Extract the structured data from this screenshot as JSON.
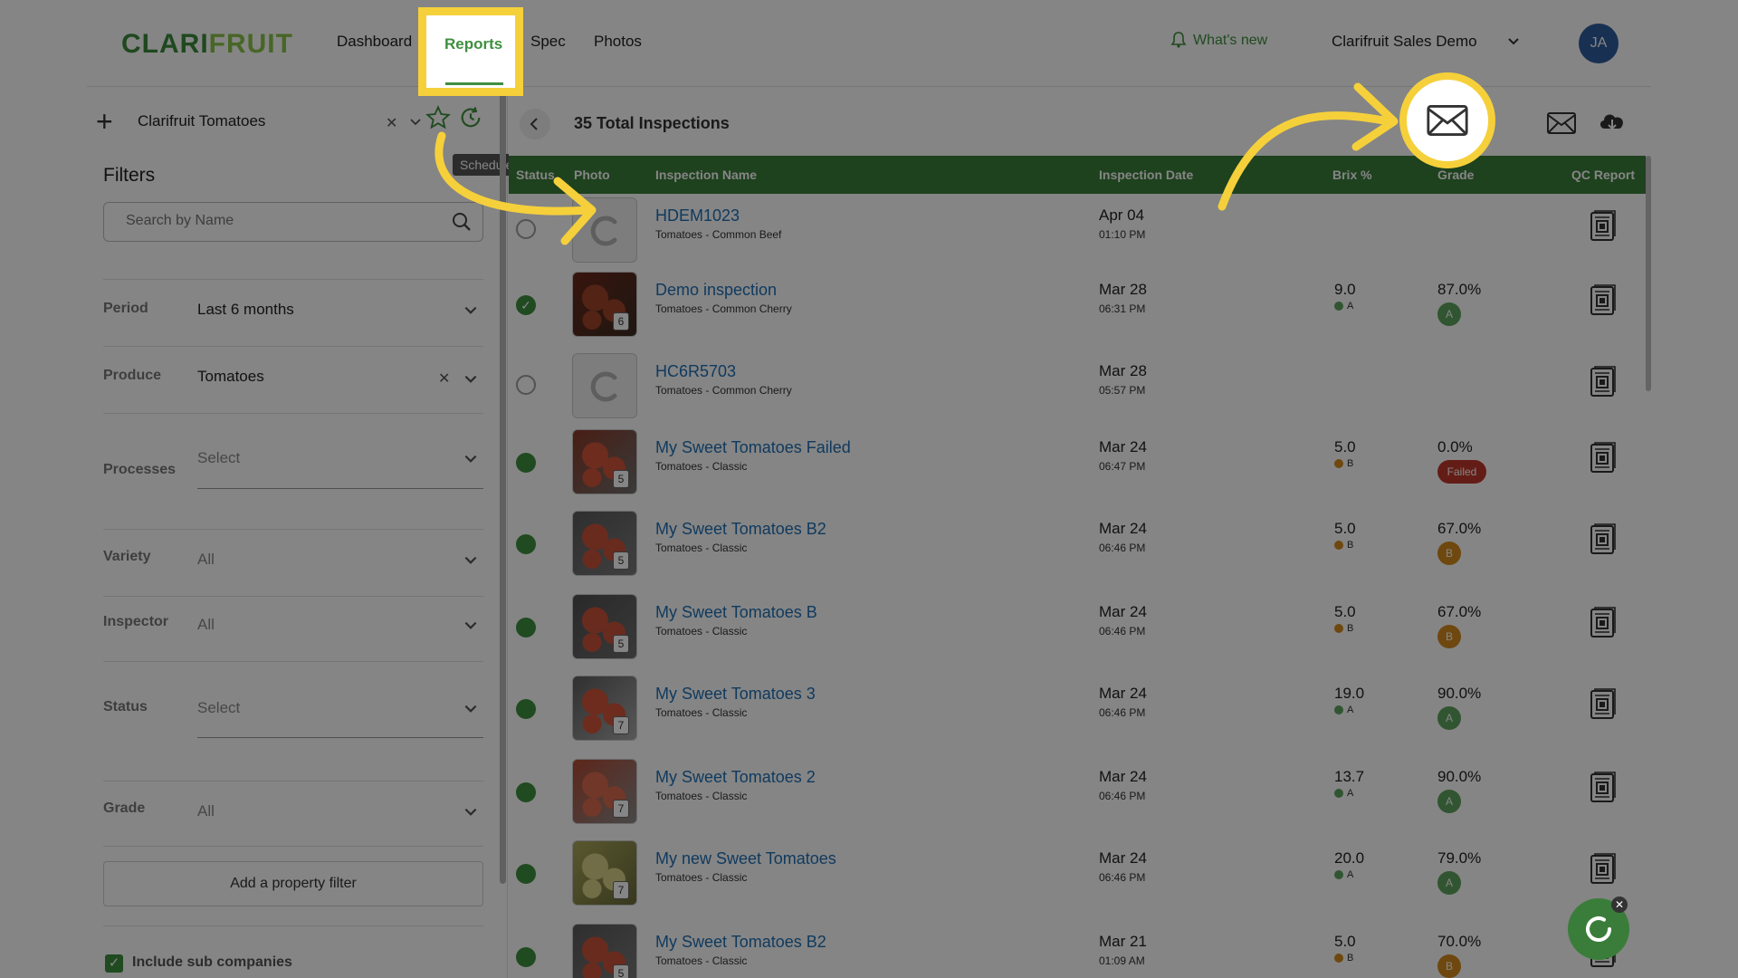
{
  "nav": {
    "logo_main": "CLARI",
    "logo_accent": "FRUIT",
    "items": [
      {
        "label": "Dashboard"
      },
      {
        "label": "Reports"
      },
      {
        "label": "Spec"
      },
      {
        "label": "Photos"
      }
    ],
    "whats_new": "What's new",
    "company": "Clarifruit Sales Demo",
    "avatar": "JA"
  },
  "sidebar": {
    "saved_view": "Clarifruit Tomatoes",
    "tooltip": "Schedule",
    "filters_title": "Filters",
    "search_placeholder": "Search by Name",
    "filters": [
      {
        "label": "Period",
        "value": "Last 6 months"
      },
      {
        "label": "Produce",
        "value": "Tomatoes"
      },
      {
        "label": "Processes",
        "value": "Select"
      },
      {
        "label": "Variety",
        "value": "All"
      },
      {
        "label": "Inspector",
        "value": "All"
      },
      {
        "label": "Status",
        "value": "Select"
      },
      {
        "label": "Grade",
        "value": "All"
      }
    ],
    "add_filter": "Add a property filter",
    "include_sub": "Include sub companies"
  },
  "main": {
    "total": "35 Total Inspections",
    "columns": {
      "status": "Status",
      "photo": "Photo",
      "name": "Inspection Name",
      "date": "Inspection Date",
      "brix": "Brix %",
      "grade": "Grade",
      "qc": "QC Report"
    },
    "rows": [
      {
        "name": "HDEM1023",
        "sub": "Tomatoes - Common Beef",
        "date": "Apr 04",
        "time": "01:10 PM",
        "brix": "",
        "brix_grade": "",
        "grade": "",
        "badge": "",
        "photo_count": ""
      },
      {
        "name": "Demo inspection",
        "sub": "Tomatoes - Common Cherry",
        "date": "Mar 28",
        "time": "06:31 PM",
        "brix": "9.0",
        "brix_grade": "A",
        "grade": "87.0%",
        "badge": "A",
        "photo_count": "6"
      },
      {
        "name": "HC6R5703",
        "sub": "Tomatoes - Common Cherry",
        "date": "Mar 28",
        "time": "05:57 PM",
        "brix": "",
        "brix_grade": "",
        "grade": "",
        "badge": "",
        "photo_count": ""
      },
      {
        "name": "My Sweet Tomatoes Failed",
        "sub": "Tomatoes - Classic",
        "date": "Mar 24",
        "time": "06:47 PM",
        "brix": "5.0",
        "brix_grade": "B",
        "grade": "0.0%",
        "badge": "Failed",
        "photo_count": "5"
      },
      {
        "name": "My Sweet Tomatoes B2",
        "sub": "Tomatoes - Classic",
        "date": "Mar 24",
        "time": "06:46 PM",
        "brix": "5.0",
        "brix_grade": "B",
        "grade": "67.0%",
        "badge": "B",
        "photo_count": "5"
      },
      {
        "name": "My Sweet Tomatoes B",
        "sub": "Tomatoes - Classic",
        "date": "Mar 24",
        "time": "06:46 PM",
        "brix": "5.0",
        "brix_grade": "B",
        "grade": "67.0%",
        "badge": "B",
        "photo_count": "5"
      },
      {
        "name": "My Sweet Tomatoes 3",
        "sub": "Tomatoes - Classic",
        "date": "Mar 24",
        "time": "06:46 PM",
        "brix": "19.0",
        "brix_grade": "A",
        "grade": "90.0%",
        "badge": "A",
        "photo_count": "7"
      },
      {
        "name": "My Sweet Tomatoes 2",
        "sub": "Tomatoes - Classic",
        "date": "Mar 24",
        "time": "06:46 PM",
        "brix": "13.7",
        "brix_grade": "A",
        "grade": "90.0%",
        "badge": "A",
        "photo_count": "7"
      },
      {
        "name": "My new Sweet Tomatoes",
        "sub": "Tomatoes - Classic",
        "date": "Mar 24",
        "time": "06:46 PM",
        "brix": "20.0",
        "brix_grade": "A",
        "grade": "79.0%",
        "badge": "A",
        "photo_count": "7"
      },
      {
        "name": "My Sweet Tomatoes B2",
        "sub": "Tomatoes - Classic",
        "date": "Mar 21",
        "time": "01:09 AM",
        "brix": "5.0",
        "brix_grade": "B",
        "grade": "70.0%",
        "badge": "B",
        "photo_count": "5"
      }
    ]
  },
  "colors": {
    "brand_green": "#3a7d3a",
    "link_blue": "#1f6fb5",
    "highlight_yellow": "#f5d03b",
    "grade_a": "#5fa35f",
    "grade_b": "#d48b1e",
    "failed_red": "#c0392b"
  },
  "icons": [
    "plus-icon",
    "close-icon",
    "chevron-down-icon",
    "star-icon",
    "schedule-icon",
    "search-icon",
    "bell-icon",
    "back-icon",
    "columns-icon",
    "sort-icon",
    "email-icon",
    "cloud-download-icon",
    "print-icon",
    "map-pin-icon",
    "qc-report-icon",
    "chat-icon"
  ]
}
